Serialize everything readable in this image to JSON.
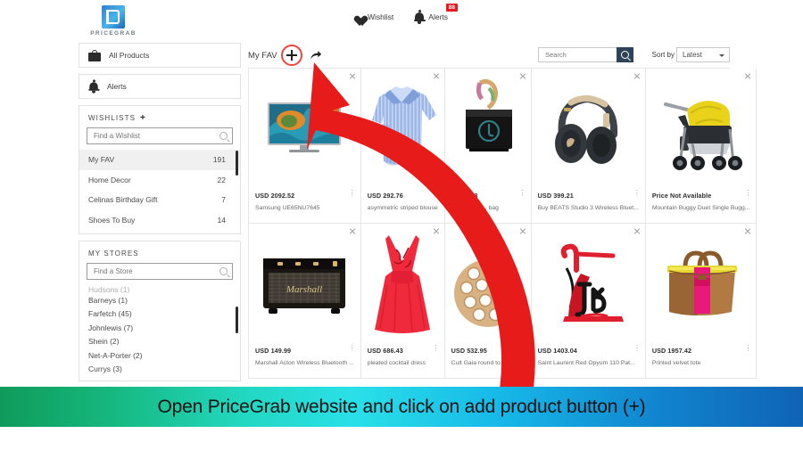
{
  "header": {
    "logo_text": "PRICEGRAB",
    "wishlist_label": "Wishlist",
    "alerts_label": "Alerts",
    "alerts_badge": "88"
  },
  "sidebar": {
    "nav": [
      {
        "label": "All Products",
        "icon": "shopping-bag-icon"
      },
      {
        "label": "Alerts",
        "icon": "bell-icon"
      }
    ],
    "wishlists": {
      "heading": "WISHLISTS",
      "add_label": "+",
      "search_placeholder": "Find a Wishlist",
      "search_value": "",
      "items": [
        {
          "label": "My FAV",
          "count": "191",
          "active": true
        },
        {
          "label": "Home Decor",
          "count": "22",
          "active": false
        },
        {
          "label": "Celinas Birthday Gift",
          "count": "7",
          "active": false
        },
        {
          "label": "Shoes To Buy",
          "count": "14",
          "active": false
        }
      ]
    },
    "stores": {
      "heading": "MY STORES",
      "search_placeholder": "Find a Store",
      "search_value": "",
      "clipped_item": "Hudsons (1)",
      "items": [
        {
          "label": "Barneys (1)"
        },
        {
          "label": "Farfetch (45)"
        },
        {
          "label": "Johnlewis (7)"
        },
        {
          "label": "Shein (2)"
        },
        {
          "label": "Net-A-Porter (2)"
        },
        {
          "label": "Currys (3)"
        }
      ]
    }
  },
  "toolbar": {
    "title": "My FAV",
    "add_product_label": "+",
    "share_label": "share",
    "search_placeholder": "Search",
    "search_value": "",
    "sort_by_label": "Sort by",
    "sort_value": "Latest"
  },
  "products": [
    {
      "price": "USD 2092.52",
      "name": "Samsung UE65NU7645",
      "img": "tv"
    },
    {
      "price": "USD 292.76",
      "name": "asymmetric striped blouse",
      "img": "blouse"
    },
    {
      "price": "USD 248",
      "name": "customisab...  bag",
      "img": "handbag-black"
    },
    {
      "price": "USD 399.21",
      "name": "Buy BEATS Studio 3 Wireless Bluet...",
      "img": "headphones"
    },
    {
      "price": "Price Not Available",
      "name": "Mountain Buggy Duet Single Bugg...",
      "img": "stroller"
    },
    {
      "price": "USD 149.99",
      "name": "Marshall Acton Wireless Bluetooth ...",
      "img": "speaker"
    },
    {
      "price": "USD 686.43",
      "name": "pleated cocktail dress",
      "img": "red-dress"
    },
    {
      "price": "USD 532.95",
      "name": "Cult Gaia round to...",
      "img": "round-bag"
    },
    {
      "price": "USD 1403.04",
      "name": "Saint Laurent Red Opyum 110 Pat...",
      "img": "red-heel"
    },
    {
      "price": "USD 1957.42",
      "name": "Printed velvet tote",
      "img": "tan-tote"
    }
  ],
  "card_menu_glyph": "⋮",
  "caption": {
    "text": "Open PriceGrab website and click on add product button (+)"
  },
  "colors": {
    "accent_red": "#f0453f",
    "badge_red": "#e8191c",
    "search_btn": "#2f4358",
    "arrow": "#e81b1b"
  }
}
